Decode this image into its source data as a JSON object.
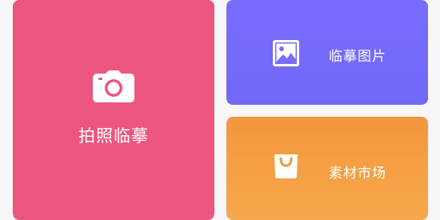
{
  "photo_card": {
    "label": "拍照临摹",
    "icon": "camera-icon",
    "color": "#ec567e"
  },
  "image_card": {
    "label": "临摹图片",
    "icon": "image-icon",
    "color": "#7a6cff"
  },
  "market_card": {
    "label": "素材市场",
    "icon": "shopping-bag-icon",
    "color": "#f4963d"
  }
}
